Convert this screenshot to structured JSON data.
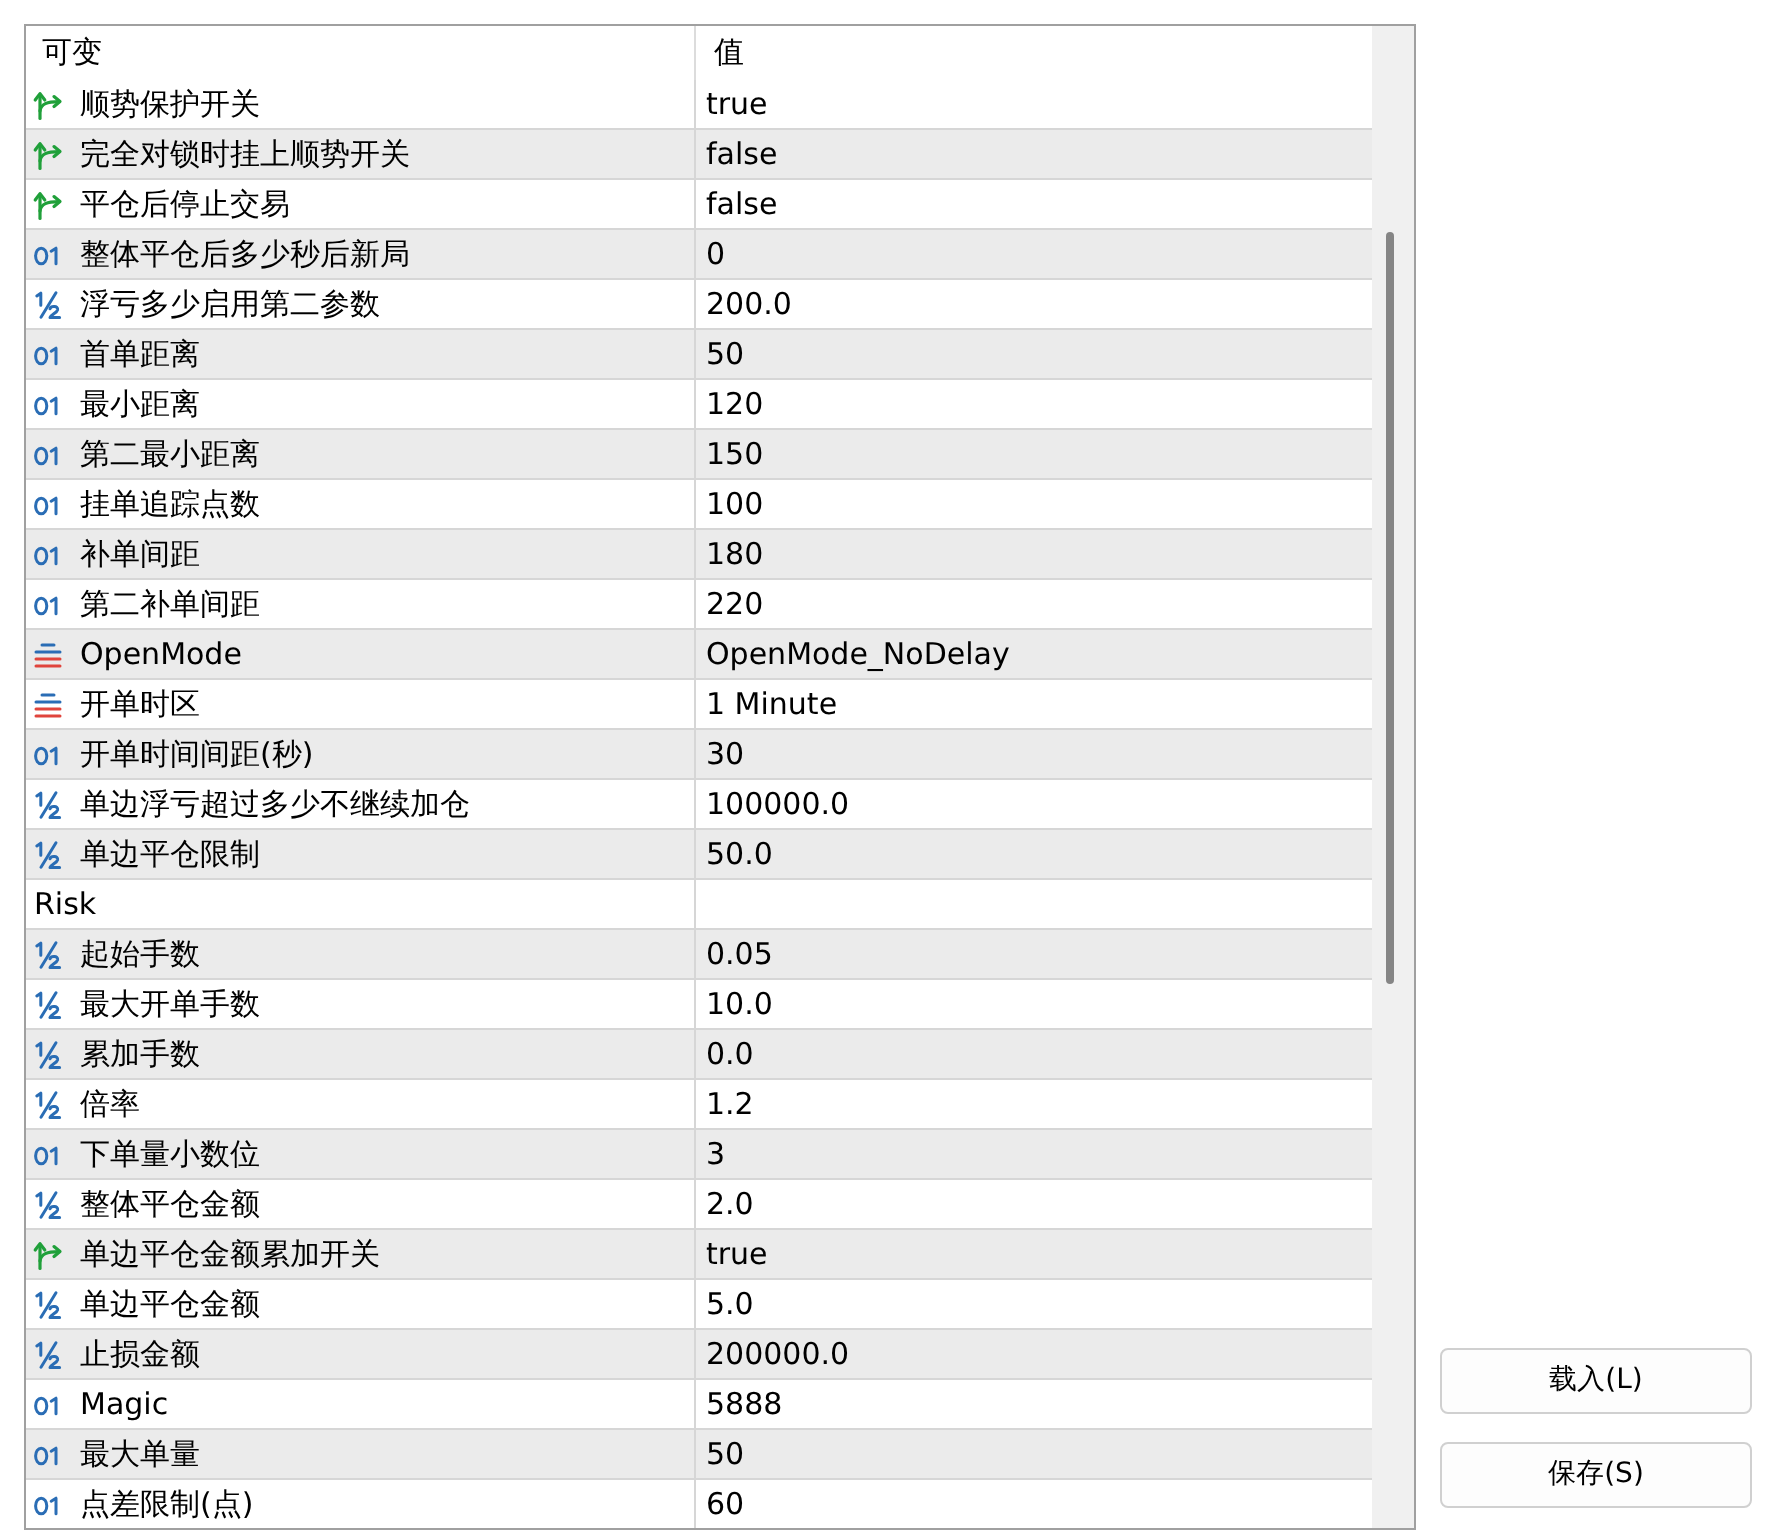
{
  "table": {
    "columns": [
      "可变",
      "值"
    ],
    "rows": [
      {
        "kind": "bool",
        "name": "顺势保护开关",
        "value": "true"
      },
      {
        "kind": "bool",
        "name": "完全对锁时挂上顺势开关",
        "value": "false"
      },
      {
        "kind": "bool",
        "name": "平仓后停止交易",
        "value": "false"
      },
      {
        "kind": "int",
        "name": "整体平仓后多少秒后新局",
        "value": "0"
      },
      {
        "kind": "double",
        "name": "浮亏多少启用第二参数",
        "value": "200.0"
      },
      {
        "kind": "int",
        "name": "首单距离",
        "value": "50"
      },
      {
        "kind": "int",
        "name": "最小距离",
        "value": "120"
      },
      {
        "kind": "int",
        "name": "第二最小距离",
        "value": "150"
      },
      {
        "kind": "int",
        "name": "挂单追踪点数",
        "value": "100"
      },
      {
        "kind": "int",
        "name": "补单间距",
        "value": "180"
      },
      {
        "kind": "int",
        "name": "第二补单间距",
        "value": "220"
      },
      {
        "kind": "enum",
        "name": "OpenMode",
        "value": "OpenMode_NoDelay"
      },
      {
        "kind": "enum",
        "name": "开单时区",
        "value": "1 Minute"
      },
      {
        "kind": "int",
        "name": "开单时间间距(秒)",
        "value": "30"
      },
      {
        "kind": "double",
        "name": "单边浮亏超过多少不继续加仓",
        "value": "100000.0"
      },
      {
        "kind": "double",
        "name": "单边平仓限制",
        "value": "50.0"
      },
      {
        "kind": "group",
        "name": "Risk"
      },
      {
        "kind": "double",
        "name": "起始手数",
        "value": "0.05"
      },
      {
        "kind": "double",
        "name": "最大开单手数",
        "value": "10.0"
      },
      {
        "kind": "double",
        "name": "累加手数",
        "value": "0.0"
      },
      {
        "kind": "double",
        "name": "倍率",
        "value": "1.2"
      },
      {
        "kind": "int",
        "name": "下单量小数位",
        "value": "3"
      },
      {
        "kind": "double",
        "name": "整体平仓金额",
        "value": "2.0"
      },
      {
        "kind": "bool",
        "name": "单边平仓金额累加开关",
        "value": "true"
      },
      {
        "kind": "double",
        "name": "单边平仓金额",
        "value": "5.0"
      },
      {
        "kind": "double",
        "name": "止损金额",
        "value": "200000.0"
      },
      {
        "kind": "int",
        "name": "Magic",
        "value": "5888"
      },
      {
        "kind": "int",
        "name": "最大单量",
        "value": "50"
      },
      {
        "kind": "int",
        "name": "点差限制(点)",
        "value": "60"
      }
    ]
  },
  "buttons": [
    {
      "label": "载入(L)"
    },
    {
      "label": "保存(S)"
    }
  ]
}
